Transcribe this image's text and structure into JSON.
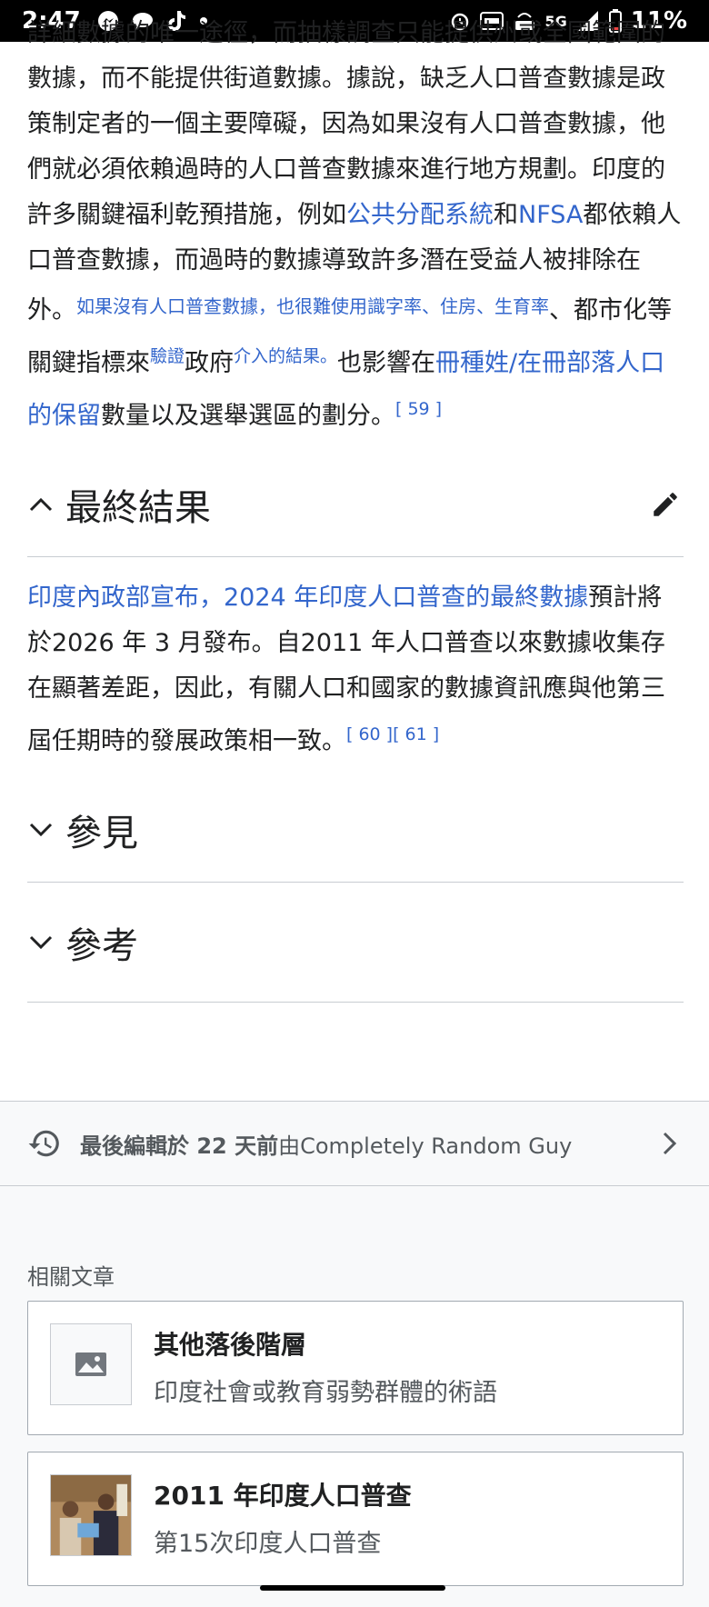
{
  "status_bar": {
    "time": "2:47",
    "network": "5G",
    "battery": "11%",
    "icons": [
      "messenger-icon",
      "chat-bubble-icon",
      "tiktok-icon",
      "dot-icon",
      "alarm-icon",
      "auto-hd-icon",
      "volte-icon",
      "signal-icon",
      "battery-icon"
    ]
  },
  "article": {
    "paragraph1": {
      "t1": "詳細數據的唯一途徑，而抽樣調查只能提供州或全國範圍的數據，而不能提供街道數據。據說，缺乏人口普查數據是政策制定者的一個主要障礙，因為如果沒有人口普查數據，他們就必須依賴過時的人口普查數據來進行地方規劃。印度的許多關鍵福利乾預措施，例如",
      "link1": "公共分配系統",
      "t2": "和",
      "link2": "NFSA",
      "t3": "都依賴人口普查數據，而過時的數據導致許多潛在受益人被排除在外。",
      "small_link1": "如果沒有人口普查數據，也很難使用識字率、住房、生育率",
      "t4": "、都市化等關鍵指標來",
      "sup1": "驗證",
      "t5": "政府",
      "sup2": "介入的結果。",
      "t6": "也影響在",
      "link3": "冊種姓/在冊部落人口的保留",
      "t7": "數量以及選舉選區的劃分。",
      "ref1": "[ 59 ]"
    },
    "section_final": {
      "title": "最終結果",
      "link": "印度內政部宣布，2024 年印度人口普查的最終數據",
      "text": "預計將於2026 年 3 月發布。自2011 年人口普查以來數據收集存在顯著差距，因此，有關人口和國家的數據資訊應與他第三屆任期時的發展政策相一致。",
      "ref1": "[ 60 ]",
      "ref2": "[ 61 ]"
    },
    "section_see_also": {
      "title": "參見"
    },
    "section_references": {
      "title": "參考"
    }
  },
  "last_edited": {
    "bold": "最後編輯於 22 天前",
    "rest": "由Completely Random Guy"
  },
  "related": {
    "label": "相關文章",
    "items": [
      {
        "title": "其他落後階層",
        "description": "印度社會或教育弱勢群體的術語"
      },
      {
        "title": "2011 年印度人口普查",
        "description": "第15次印度人口普查"
      }
    ]
  }
}
